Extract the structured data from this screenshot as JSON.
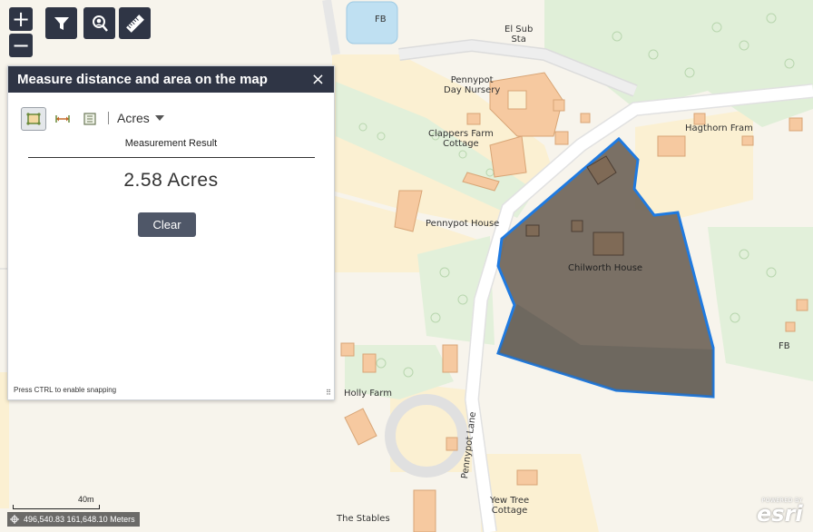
{
  "toolbar": {
    "zoom_in": "+",
    "zoom_out": "−"
  },
  "panel": {
    "title": "Measure distance and area on the map",
    "close": "×",
    "unit": "Acres",
    "result_heading": "Measurement Result",
    "result_value": "2.58 Acres",
    "clear_label": "Clear",
    "snap_hint": "Press CTRL to enable snapping"
  },
  "map": {
    "labels": {
      "fb_top": "FB",
      "el_sub_sta": "El Sub\nSta",
      "pennypot_day_nursery": "Pennypot\nDay Nursery",
      "hagthorn_fram": "Hagthorn Fram",
      "clappers_farm_cottage": "Clappers Farm\nCottage",
      "pennypot_house": "Pennypot House",
      "chilworth_house": "Chilworth House",
      "fb_right": "FB",
      "holly_farm": "Holly Farm",
      "pennypot_lane": "Pennypot Lane",
      "yew_tree_cottage": "Yew Tree\nCottage",
      "the_stables": "The Stables"
    },
    "measured_area_color": "#6b6257",
    "outline_color": "#1f7ae0"
  },
  "scalebar": {
    "label": "40m"
  },
  "coordinates": {
    "text": "496,540.83 161,648.10 Meters"
  },
  "attribution": {
    "powered_by": "POWERED BY",
    "logo": "esri"
  }
}
